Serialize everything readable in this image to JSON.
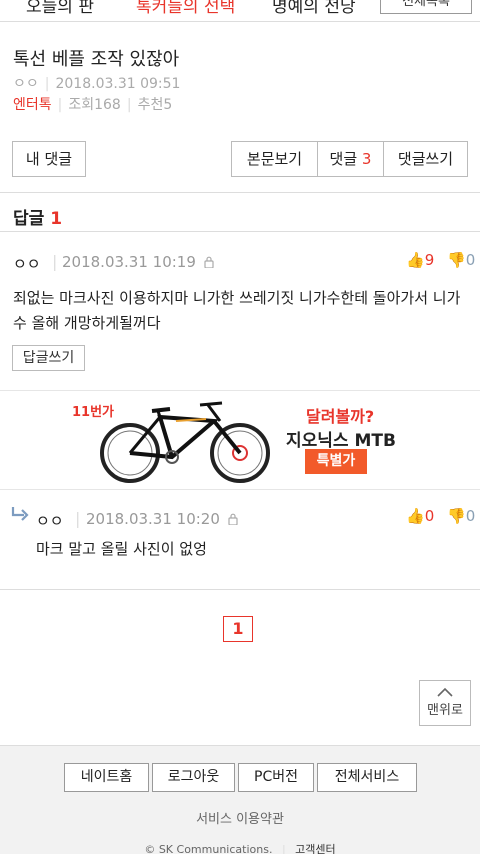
{
  "top_nav": {
    "tabs": [
      "오늘의 판",
      "톡커들의 선택",
      "명예의 전당"
    ],
    "all_list": "전체목록"
  },
  "post": {
    "title": "톡선 베플 조작 있잖아",
    "author": "ㅇㅇ",
    "date": "2018.03.31 09:51",
    "category": "엔터톡",
    "views": "조회168",
    "recommend": "추천5"
  },
  "buttons": {
    "my_comments": "내 댓글",
    "view_post": "본문보기",
    "comments_label": "댓글",
    "comments_count": "3",
    "write_comment": "댓글쓰기"
  },
  "reply_section": {
    "label": "답글",
    "count": "1"
  },
  "comment": {
    "author": "ㅇㅇ",
    "date": "2018.03.31 10:19",
    "up": "9",
    "down": "0",
    "text": "죄없는 마크사진 이용하지마 니가한 쓰레기짓 니가수한테 돌아가서 니가수 올해 개망하게될꺼다",
    "reply_button": "답글쓰기"
  },
  "ad": {
    "brand": "11번가",
    "line1": "달려볼까?",
    "line2": "지오닉스 MTB",
    "line3": "특별가"
  },
  "reply": {
    "author": "ㅇㅇ",
    "date": "2018.03.31 10:20",
    "up": "0",
    "down": "0",
    "text": "마크 말고 올릴 사진이 없엉"
  },
  "pagination": {
    "current": "1"
  },
  "to_top": "맨위로",
  "footer": {
    "links": [
      "네이트홈",
      "로그아웃",
      "PC버전",
      "전체서비스"
    ],
    "terms": "서비스 이용약관",
    "copyright": "© SK Communications.",
    "support": "고객센터"
  },
  "colors": {
    "accent": "#e8352b",
    "down_vote": "#8aa0b4",
    "footer_bg": "#f2f2f2"
  }
}
